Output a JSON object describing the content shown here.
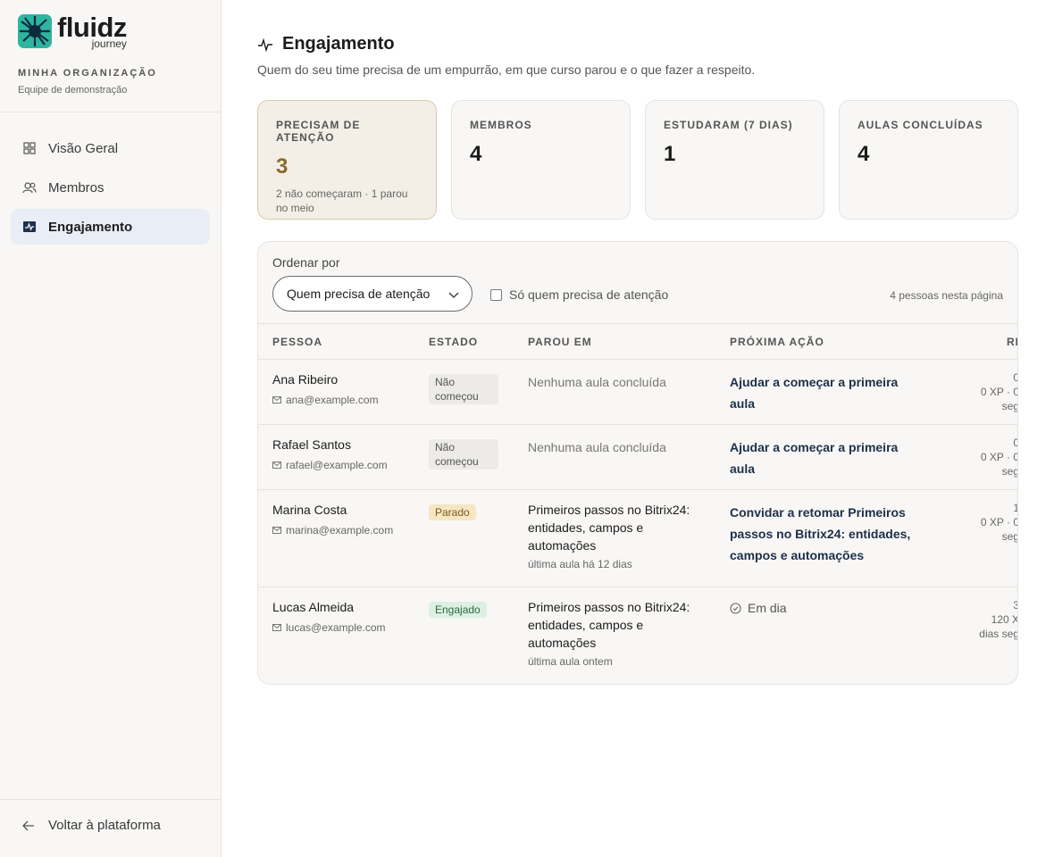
{
  "brand": {
    "name": "fluidz",
    "sub": "journey"
  },
  "org": {
    "label": "MINHA ORGANIZAÇÃO",
    "team": "Equipe de demonstração"
  },
  "nav": [
    {
      "label": "Visão Geral",
      "icon": "grid-icon"
    },
    {
      "label": "Membros",
      "icon": "users-icon"
    },
    {
      "label": "Engajamento",
      "icon": "activity-icon",
      "active": true
    }
  ],
  "back": {
    "label": "Voltar à plataforma"
  },
  "page": {
    "title": "Engajamento",
    "subtitle": "Quem do seu time precisa de um empurrão, em que curso parou e o que fazer a respeito."
  },
  "cards": [
    {
      "label": "PRECISAM DE ATENÇÃO",
      "value": "3",
      "note": "2 não começaram · 1 parou no meio"
    },
    {
      "label": "MEMBROS",
      "value": "4"
    },
    {
      "label": "ESTUDARAM (7 DIAS)",
      "value": "1"
    },
    {
      "label": "AULAS CONCLUÍDAS",
      "value": "4"
    }
  ],
  "controls": {
    "sort_label": "Ordenar por",
    "sort_value": "Quem precisa de atenção",
    "filter_label": "Só quem precisa de atenção",
    "count": "4 pessoas nesta página"
  },
  "columns": [
    "PESSOA",
    "ESTADO",
    "PAROU EM",
    "PRÓXIMA AÇÃO",
    "RI"
  ],
  "rows": [
    {
      "name": "Ana Ribeiro",
      "email": "ana@example.com",
      "status": "Não começou",
      "stopped": "Nenhuma aula concluída",
      "action": "Ajudar a começar a primeira aula",
      "rhythm": [
        "0",
        "0 XP · 0",
        "seg"
      ]
    },
    {
      "name": "Rafael Santos",
      "email": "rafael@example.com",
      "status": "Não começou",
      "stopped": "Nenhuma aula concluída",
      "action": "Ajudar a começar a primeira aula",
      "rhythm": [
        "0",
        "0 XP · 0",
        "seg"
      ]
    },
    {
      "name": "Marina Costa",
      "email": "marina@example.com",
      "status": "Parado",
      "stopped": "Primeiros passos no Bitrix24: entidades, campos e automações",
      "stopped_sub": "última aula há 12 dias",
      "action": "Convidar a retomar Primeiros passos no Bitrix24: entidades, campos e automações",
      "rhythm": [
        "1",
        "0 XP · 0",
        "seg"
      ]
    },
    {
      "name": "Lucas Almeida",
      "email": "lucas@example.com",
      "status": "Engajado",
      "stopped": "Primeiros passos no Bitrix24: entidades, campos e automações",
      "stopped_sub": "última aula ontem",
      "action": "Em dia",
      "rhythm": [
        "3",
        "120 X",
        "dias seg"
      ]
    }
  ],
  "colors": {
    "accent_nav": "#e9eef6",
    "alert_card": "#f3efe6",
    "alert_value": "#8a6a2a",
    "action_text": "#1d2f4a"
  }
}
